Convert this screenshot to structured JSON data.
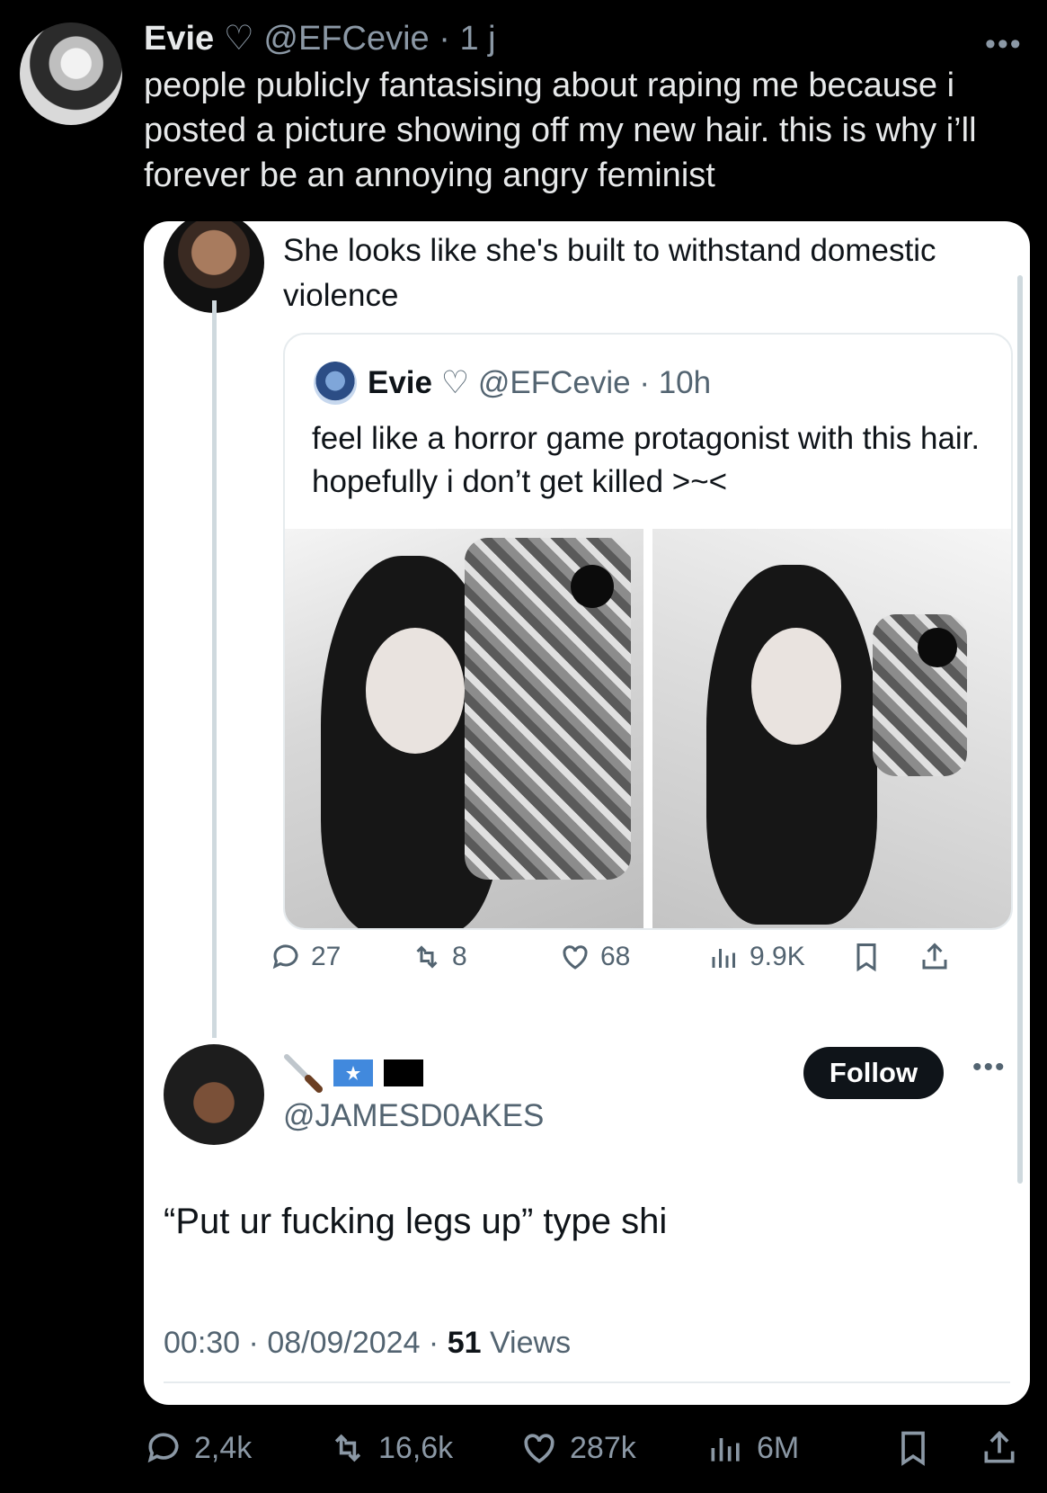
{
  "outer_tweet": {
    "name": "Evie",
    "heart": "♡",
    "handle": "@EFCevie",
    "time": "1 j",
    "text": "people publicly fantasising about raping me because i posted a picture showing off my new hair. this is why i’ll forever be an annoying angry feminist",
    "more": "•••",
    "stats": {
      "replies": "2,4k",
      "reposts": "16,6k",
      "likes": "287k",
      "views": "6M"
    }
  },
  "screenshot": {
    "reply": {
      "text": "She looks like she's built to withstand domestic violence"
    },
    "quote": {
      "name": "Evie",
      "heart": "♡",
      "handle": "@EFCevie",
      "time": "10h",
      "text": "feel like a horror game protagonist with this hair. hopefully i don’t get killed >~<"
    },
    "quote_stats": {
      "replies": "27",
      "reposts": "8",
      "likes": "68",
      "views": "9.9K"
    },
    "second_reply": {
      "handle": "@JAMESD0AKES",
      "follow_label": "Follow",
      "more": "•••",
      "text": "“Put ur fucking legs up” type shi",
      "time": "00:30",
      "date": "08/09/2024",
      "views_count": "51",
      "views_label": "Views"
    }
  },
  "colors": {
    "background": "#000000",
    "card": "#ffffff",
    "muted_dark": "#8b98a5",
    "muted_light": "#536471",
    "text_light": "#0f1419"
  }
}
